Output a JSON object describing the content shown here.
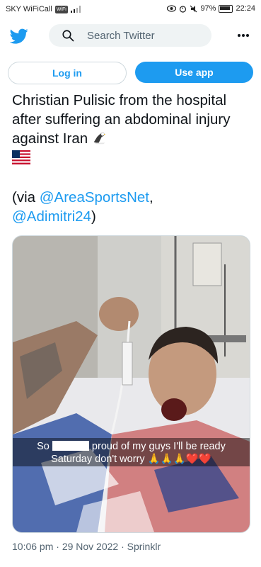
{
  "status_bar": {
    "carrier": "SKY WiFiCall",
    "wifi_badge": "WiFi",
    "battery": "97%",
    "time": "22:24"
  },
  "header": {
    "logo": "twitter-bird-icon",
    "search_placeholder": "Search Twitter",
    "more": "more-icon"
  },
  "buttons": {
    "login": "Log in",
    "use_app": "Use app"
  },
  "tweet": {
    "text": "Christian Pulisic from the hospital after suffering an abdominal injury against Iran",
    "emoji_eagle": "eagle-emoji",
    "emoji_flag": "us-flag-emoji",
    "via_prefix": "(via ",
    "mention1": "@AreaSportsNet",
    "comma": ",",
    "mention2": "@Adimitri24",
    "via_suffix": ")"
  },
  "media": {
    "caption_line1_a": "So",
    "caption_line1_b": "proud of my guys I'll be ready",
    "caption_line2": "Saturday don't worry 🙏🙏🙏❤️❤️"
  },
  "meta": {
    "timestamp": "10:06 pm · 29 Nov 2022 · Sprinklr"
  },
  "colors": {
    "accent": "#1d9bf0",
    "text": "#0f1419",
    "muted": "#536471"
  }
}
